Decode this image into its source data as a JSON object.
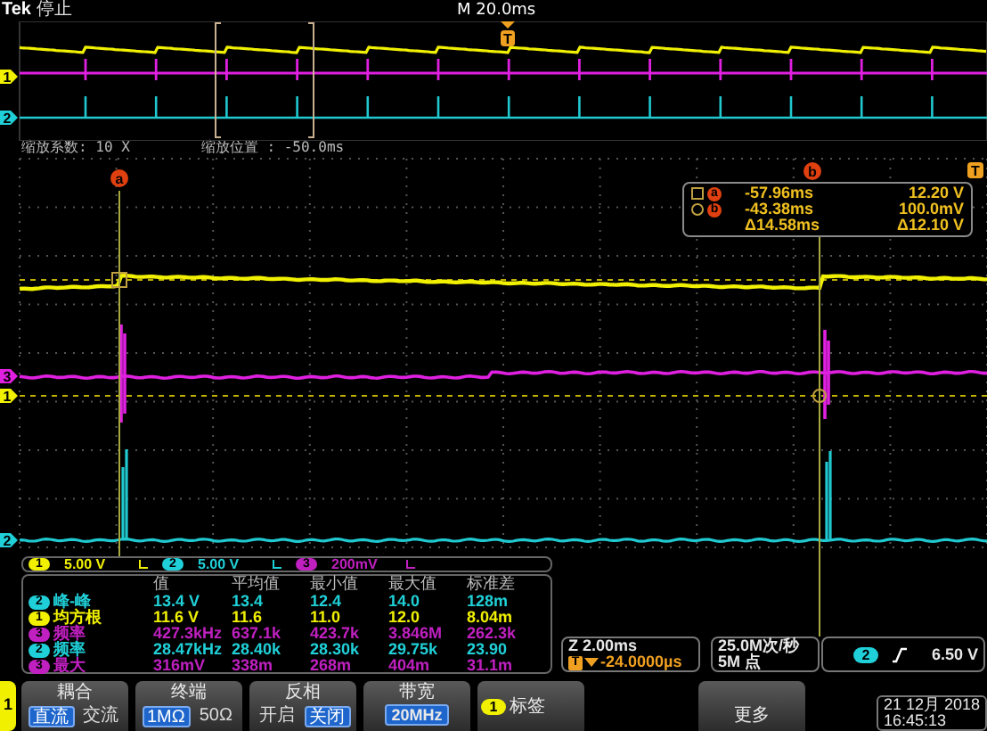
{
  "header": {
    "brand": "Tek",
    "run_state": "停止",
    "timebase": "M 20.0ms"
  },
  "overview": {
    "trigger_marker": "T",
    "channel_markers": [
      {
        "label": "1",
        "color": "#f0f000"
      },
      {
        "label": "2",
        "color": "#20d0d8"
      }
    ]
  },
  "zoom_info": {
    "factor": "缩放系数: 10 X",
    "position": "缩放位置 : -50.0ms"
  },
  "plot": {
    "trigger_marker": "T",
    "cursors": [
      {
        "label": "a"
      },
      {
        "label": "b"
      }
    ],
    "channel_markers": [
      {
        "label": "3",
        "color": "#e020e0"
      },
      {
        "label": "1",
        "color": "#f0f000"
      },
      {
        "label": "2",
        "color": "#20d0d8"
      }
    ]
  },
  "cursor_readout": [
    {
      "kind": "square",
      "cursor": "a",
      "time": "-57.96ms",
      "value": "12.20 V"
    },
    {
      "kind": "circle",
      "cursor": "b",
      "time": "-43.38ms",
      "value": "100.0mV"
    },
    {
      "kind": "delta",
      "time": "Δ14.58ms",
      "value": "Δ12.10 V"
    }
  ],
  "vertical_scales": [
    {
      "channel": "1",
      "scale": "5.00 V",
      "color": "#f0f000"
    },
    {
      "channel": "2",
      "scale": "5.00 V",
      "color": "#20d0d8"
    },
    {
      "channel": "3",
      "scale": "200mV",
      "color": "#c020c0"
    }
  ],
  "measurements": {
    "columns": [
      "值",
      "平均值",
      "最小值",
      "最大值",
      "标准差"
    ],
    "rows": [
      {
        "channel": "2",
        "color": "#20d0d8",
        "name": "峰-峰",
        "values": [
          "13.4 V",
          "13.4",
          "12.4",
          "14.0",
          "128m"
        ]
      },
      {
        "channel": "1",
        "color": "#f0f000",
        "name": "均方根",
        "values": [
          "11.6 V",
          "11.6",
          "11.0",
          "12.0",
          "8.04m"
        ]
      },
      {
        "channel": "3",
        "color": "#c020c0",
        "name": "频率",
        "values": [
          "427.3kHz",
          "637.1k",
          "423.7k",
          "3.846M",
          "262.3k"
        ]
      },
      {
        "channel": "2",
        "color": "#20d0d8",
        "name": "频率",
        "values": [
          "28.47kHz",
          "28.40k",
          "28.30k",
          "29.75k",
          "23.90"
        ]
      },
      {
        "channel": "3",
        "color": "#c020c0",
        "name": "最大",
        "values": [
          "316mV",
          "338m",
          "268m",
          "404m",
          "31.1m"
        ]
      }
    ]
  },
  "horizontal": {
    "scale": "Z 2.00ms",
    "trigger_marker": "T",
    "delay": "-24.0000µs"
  },
  "acquisition": {
    "sample_rate": "25.0M次/秒",
    "record_length": "5M 点"
  },
  "trigger": {
    "source": "2",
    "color": "#20d0d8",
    "level": "6.50 V"
  },
  "menu": {
    "channel_tab": "1",
    "items": [
      {
        "kind": "toggle",
        "title": "耦合",
        "options": [
          {
            "label": "直流",
            "selected": true
          },
          {
            "label": "交流",
            "selected": false
          }
        ]
      },
      {
        "kind": "toggle",
        "title": "终端",
        "options": [
          {
            "label": "1MΩ",
            "selected": true
          },
          {
            "label": "50Ω",
            "selected": false
          }
        ]
      },
      {
        "kind": "toggle",
        "title": "反相",
        "options": [
          {
            "label": "开启",
            "selected": false
          },
          {
            "label": "关闭",
            "selected": true
          }
        ]
      },
      {
        "kind": "value",
        "title": "带宽",
        "value": "20MHz"
      },
      {
        "kind": "label",
        "channel": "1",
        "title": "标签"
      },
      {
        "kind": "more",
        "title": "更多"
      }
    ]
  },
  "datetime": {
    "date": "21 12月 2018",
    "time": "16:45:13"
  }
}
